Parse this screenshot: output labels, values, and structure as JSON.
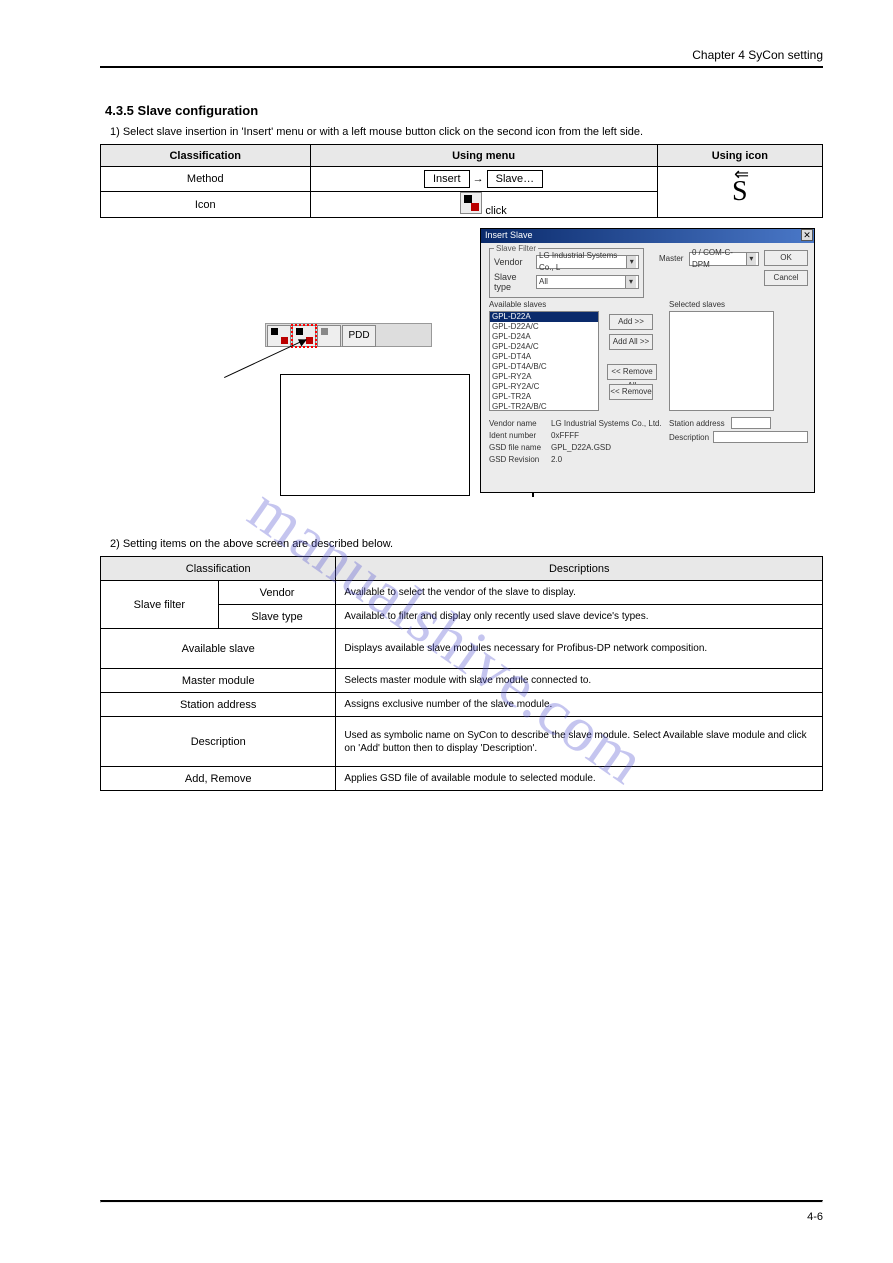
{
  "header": {
    "chapter": "Chapter 4 SyCon setting"
  },
  "section_slave_config": {
    "title": "4.3.5 Slave configuration",
    "intro": "1) Select slave insertion in 'Insert' menu or with a left mouse button click on the second icon from the left side.",
    "table1": {
      "headers": [
        "Classification",
        "Using menu",
        "Using icon"
      ],
      "rows": [
        {
          "c0": "Method",
          "c1_box1": "Insert",
          "c1_mid": " → ",
          "c1_box2": "Slave…",
          "c2": "S"
        },
        {
          "c0": "Icon",
          "c1_icon": true,
          "c1_note": " click",
          "c2": "S"
        }
      ]
    }
  },
  "dialog": {
    "title": "Insert Slave",
    "group_label": "Slave Filter",
    "vendor_label": "Vendor",
    "vendor_value": "LG Industrial Systems Co., L",
    "slave_type_label": "Slave type",
    "slave_type_value": "All",
    "master_label": "Master",
    "master_value": "0 / COM-C-DPM",
    "btn_ok": "OK",
    "btn_cancel": "Cancel",
    "left_title": "Available slaves",
    "right_title": "Selected slaves",
    "btn_add": "Add >>",
    "btn_addall": "Add All >>",
    "btn_removeall": "<< Remove All",
    "btn_remove": "<< Remove",
    "slaves": [
      "GPL-D22A",
      "GPL-D22A/C",
      "GPL-D24A",
      "GPL-D24A/C",
      "GPL-DT4A",
      "GPL-DT4A/B/C",
      "GPL-RY2A",
      "GPL-RY2A/C",
      "GPL-TR2A",
      "GPL-TR2A/B/C"
    ],
    "vendor_name_label": "Vendor name",
    "vendor_name_value": "LG Industrial Systems Co., Ltd.",
    "ident_label": "Ident number",
    "ident_value": "0xFFFF",
    "gsd_label": "GSD file name",
    "gsd_value": "GPL_D22A.GSD",
    "rev_label": "GSD Revision",
    "rev_value": "2.0",
    "station_label": "Station address",
    "desc_label": "Description"
  },
  "section_setting_items": {
    "intro": "2) Setting items on the above screen are described below.",
    "headers": [
      "Classification",
      "Descriptions"
    ],
    "rows": [
      {
        "a": "Slave filter",
        "b": "Vendor",
        "c": "Available to select the vendor of the slave to display."
      },
      {
        "a": "",
        "b": "Slave type",
        "c": "Available to filter and display only recently used slave device's types."
      },
      {
        "a2": "Available slave",
        "c": "Displays available slave modules necessary for Profibus-DP network composition."
      },
      {
        "a2": "Master module",
        "c": "Selects master module with slave module connected to."
      },
      {
        "a2": "Station address",
        "c": "Assigns exclusive number of the slave module."
      },
      {
        "a2": "Description",
        "c": "Used as symbolic name on SyCon to describe the slave module.\nSelect Available slave module and click on 'Add' button then to display 'Description'."
      },
      {
        "a2": "Add, Remove",
        "c": "Applies GSD file of available module to selected module."
      }
    ]
  },
  "pdd_label": "PDD",
  "footer": {
    "page": "4-6"
  }
}
